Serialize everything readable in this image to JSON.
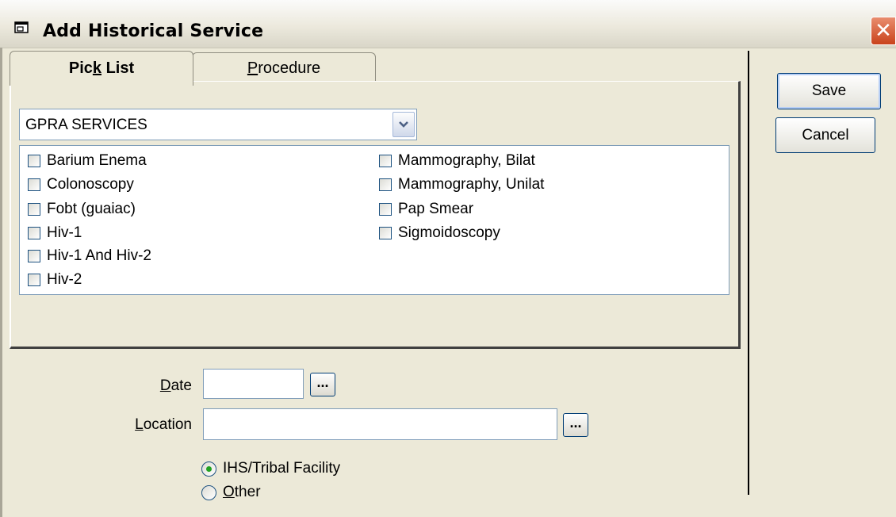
{
  "window": {
    "title": "Add Historical Service",
    "close_glyph": "✕"
  },
  "tabs": [
    {
      "label_pre": "Pic",
      "label_ul": "k",
      "label_post": " List"
    },
    {
      "label_pre": "",
      "label_ul": "P",
      "label_post": "rocedure"
    }
  ],
  "picklist": {
    "selected": "GPRA SERVICES",
    "items_left": [
      "Barium Enema",
      "Colonoscopy",
      "Fobt (guaiac)",
      "Hiv-1",
      "Hiv-1 And Hiv-2",
      "Hiv-2"
    ],
    "items_right": [
      "Mammography, Bilat",
      "Mammography, Unilat",
      "Pap Smear",
      "Sigmoidoscopy"
    ]
  },
  "buttons": {
    "save": "Save",
    "cancel": "Cancel",
    "ellipsis": "..."
  },
  "form": {
    "date_label_ul": "D",
    "date_label_rest": "ate",
    "date_value": "",
    "location_label_ul": "L",
    "location_label_rest": "ocation",
    "location_value": ""
  },
  "facility": {
    "option1": "IHS/Tribal Facility",
    "option2_ul": "O",
    "option2_rest": "ther",
    "selected": "IHS/Tribal Facility"
  },
  "colors": {
    "face": "#ece9d8",
    "close": "#c9431c",
    "radio_dot": "#21a121"
  }
}
